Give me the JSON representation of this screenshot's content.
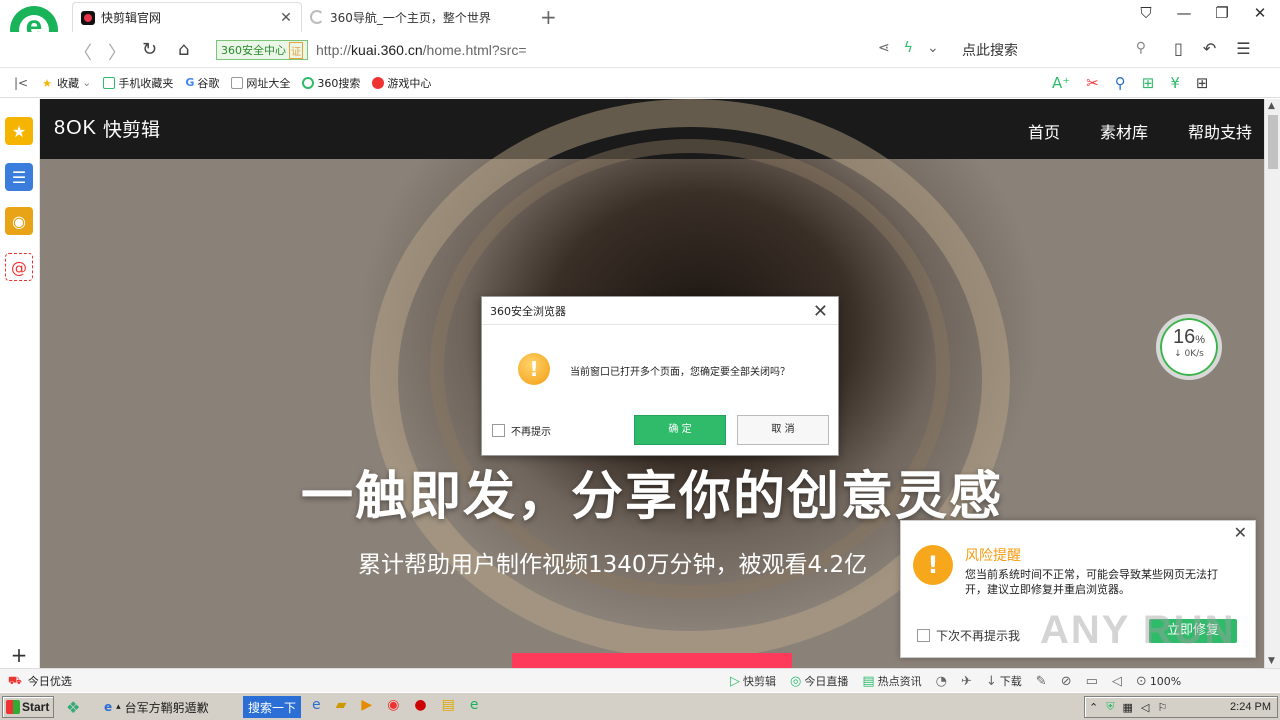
{
  "browser": {
    "tabs": [
      {
        "title": "快剪辑官网",
        "active": true
      },
      {
        "title": "360导航_一个主页，整个世界",
        "active": false
      }
    ],
    "security_badge": "360安全中心",
    "security_badge_mark": "证",
    "url_prefix": "http://",
    "url_host": "kuai.360.cn",
    "url_path": "/home.html?src=",
    "search_placeholder": "点此搜索",
    "bookmarks": [
      {
        "label": "收藏",
        "icon": "star-icon"
      },
      {
        "label": "手机收藏夹",
        "icon": "phone-icon"
      },
      {
        "label": "谷歌",
        "icon": "google-icon"
      },
      {
        "label": "网址大全",
        "icon": "page-icon"
      },
      {
        "label": "360搜索",
        "icon": "search-360-icon"
      },
      {
        "label": "游戏中心",
        "icon": "game-icon"
      }
    ]
  },
  "site": {
    "logo_mark": "8OK",
    "logo_text": "快剪辑",
    "nav": [
      "首页",
      "素材库",
      "帮助支持"
    ],
    "hero_title": "一触即发，分享你的创意灵感",
    "hero_subtitle": "累计帮助用户制作视频1340万分钟，被观看4.2亿"
  },
  "speed_widget": {
    "percent": "16",
    "percent_unit": "%",
    "rate": "↓ 0K/s"
  },
  "dialog": {
    "title": "360安全浏览器",
    "message": "当前窗口已打开多个页面，您确定要全部关闭吗？",
    "checkbox_label": "不再提示",
    "ok_label": "确 定",
    "cancel_label": "取 消"
  },
  "risk_popup": {
    "title": "风险提醒",
    "text": "您当前系统时间不正常，可能会导致某些网页无法打开，建议立即修复并重启浏览器。",
    "checkbox_label": "下次不再提示我",
    "button_label": "立即修复"
  },
  "watermark": "ANY RUN",
  "statusbar": {
    "left_label": "今日优选",
    "items": [
      "快剪辑",
      "今日直播",
      "热点资讯"
    ],
    "download_label": "下载",
    "zoom": "100%"
  },
  "taskbar": {
    "start_label": "Start",
    "ie_task": "台军方鞘躬遁歉",
    "search_button": "搜索一下",
    "clock": "2:24 PM"
  },
  "colors": {
    "accent_green": "#2fbb6a",
    "warn_orange": "#f39c12",
    "cta_red": "#ff3b5c"
  }
}
